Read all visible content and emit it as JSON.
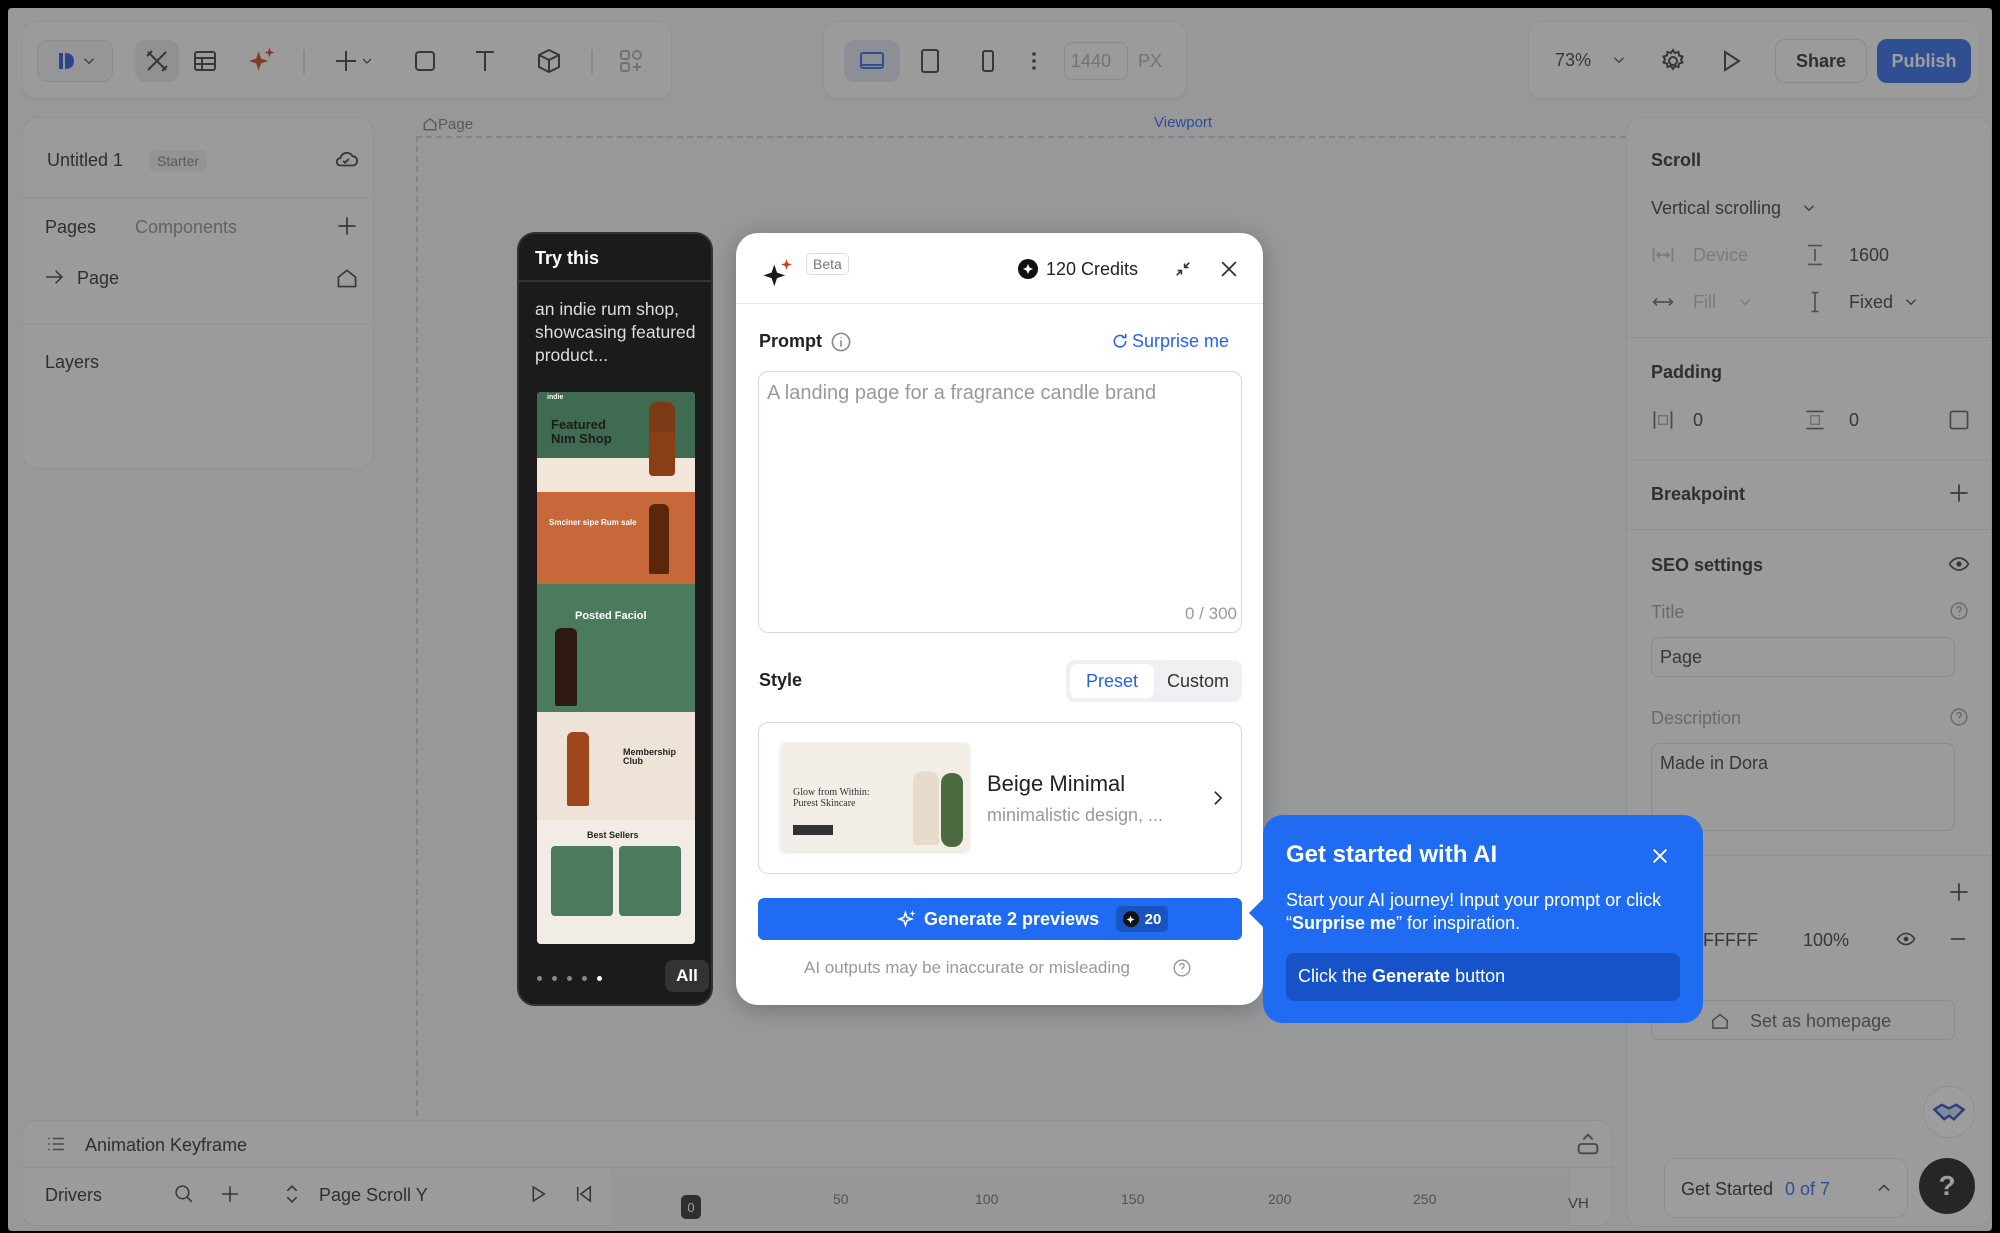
{
  "toolbar": {
    "zoom": "73%",
    "width_value": "1440",
    "width_unit": "PX",
    "share_label": "Share",
    "publish_label": "Publish"
  },
  "canvas": {
    "page_label": "Page",
    "viewport_label": "Viewport"
  },
  "left_panel": {
    "project_name": "Untitled 1",
    "plan_badge": "Starter",
    "tab_pages": "Pages",
    "tab_components": "Components",
    "page_item": "Page",
    "layers_title": "Layers"
  },
  "right_panel": {
    "scroll_title": "Scroll",
    "scroll_mode": "Vertical scrolling",
    "device_label": "Device",
    "height_value": "1600",
    "fill_label": "Fill",
    "fixed_label": "Fixed",
    "padding_title": "Padding",
    "padding_h": "0",
    "padding_v": "0",
    "breakpoint_title": "Breakpoint",
    "seo_title": "SEO settings",
    "title_label": "Title",
    "title_value": "Page",
    "description_label": "Description",
    "description_value": "Made in Dora",
    "color_value": "FFFFF",
    "opacity_value": "100%",
    "homepage_label": "Set as homepage"
  },
  "bottom_panel": {
    "keyframe_title": "Animation Keyframe",
    "drivers_label": "Drivers",
    "driver_name": "Page Scroll Y",
    "unit_label": "VH",
    "ticks": [
      "0",
      "50",
      "100",
      "150",
      "200",
      "250"
    ]
  },
  "get_started": {
    "label": "Get Started",
    "progress": "0 of 7",
    "help": "?"
  },
  "try_this": {
    "title": "Try this",
    "prompt": "an indie rum shop, showcasing featured product...",
    "all_label": "All",
    "preview": {
      "brand": "indie",
      "hero_title": "Featured Nım Shop",
      "section2": "Smciner sipe Rum sale",
      "section3": "Posted Faciol",
      "section4": "Membership Club",
      "section5": "Best Sellers"
    }
  },
  "modal": {
    "beta": "Beta",
    "credits": "120 Credits",
    "prompt_label": "Prompt",
    "surprise_label": "Surprise me",
    "prompt_placeholder": "A landing page for a fragrance candle brand",
    "char_count": "0 / 300",
    "style_label": "Style",
    "preset_label": "Preset",
    "custom_label": "Custom",
    "style_name": "Beige Minimal",
    "style_desc": "minimalistic design, ...",
    "style_thumb_title": "Glow from Within: Purest Skincare",
    "generate_label": "Generate 2 previews",
    "generate_cost": "20",
    "disclaimer": "AI outputs may be inaccurate or misleading"
  },
  "tip": {
    "title": "Get started with AI",
    "body_start": "Start your AI journey! Input your prompt or click “",
    "body_bold": "Surprise me",
    "body_end": "” for inspiration.",
    "action_start": "Click the ",
    "action_bold": "Generate",
    "action_end": " button"
  },
  "colors": {
    "accent": "#1f6bf2",
    "publish": "#2563eb"
  }
}
